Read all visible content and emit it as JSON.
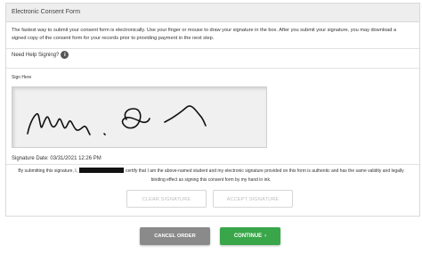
{
  "panel": {
    "title": "Electronic Consent Form",
    "intro": "The fastest way to submit your consent form is electronically. Use your finger or mouse to draw your signature in the box. After you submit your signature, you may download a signed copy of the consent form for your records prior to providing payment in the next step.",
    "help_label": "Need Help Signing?",
    "help_icon": "info-icon",
    "sign_label": "Sign Here",
    "signature_date_label": "Signature Date:",
    "signature_date": "03/31/2021 12:26 PM",
    "cert_prefix": "By submitting this signature, I,",
    "cert_suffix": "certify that I am the above-named student and my electronic signature provided on this form is authentic and has the same validity and legally binding effect as signing this consent form by my hand in ink.",
    "clear_label": "CLEAR SIGNATURE",
    "accept_label": "ACCEPT SIGNATURE"
  },
  "footer": {
    "cancel_label": "CANCEL ORDER",
    "continue_label": "CONTINUE",
    "continue_icon": "chevron-right-icon"
  },
  "colors": {
    "continue": "#3aa64a",
    "cancel": "#8a8a8a",
    "header_bg": "#eeeeee"
  }
}
